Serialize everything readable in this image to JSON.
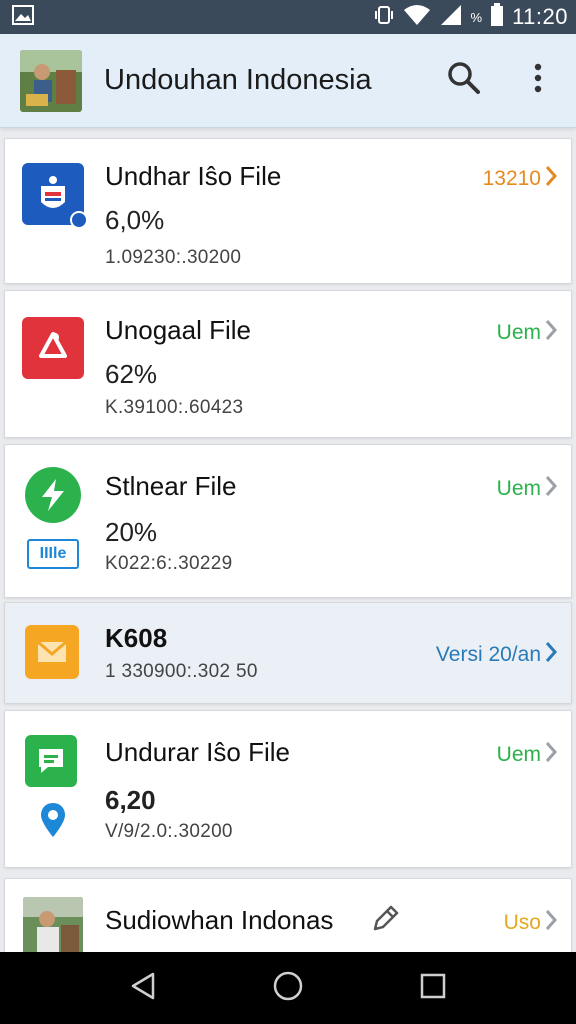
{
  "status_bar": {
    "time": "11:20",
    "battery_pct_label": "%",
    "icons": [
      "image-icon",
      "vibrate-icon",
      "wifi-icon",
      "signal-icon",
      "battery-icon"
    ]
  },
  "app_bar": {
    "title": "Undouhan Indonesia",
    "actions": [
      "search-icon",
      "more-vert-icon"
    ]
  },
  "items": [
    {
      "name": "Undhar Iŝo File",
      "percent": "6,0%",
      "meta": "1.09230:.30200",
      "right_label": "13210",
      "right_color": "#e58a1f",
      "icon": "shield-app-icon",
      "icon_bg": "#1e5bbf"
    },
    {
      "name": "Unogaal File",
      "percent": "62%",
      "meta": "K.39100:.60423",
      "right_label": "Uem",
      "right_color": "#2bb24c",
      "icon": "hanger-app-icon",
      "icon_bg": "#e0333b"
    },
    {
      "name": "Stlnear File",
      "percent": "20%",
      "meta": "K022:6:.30229",
      "right_label": "Uem",
      "right_color": "#2bb24c",
      "icon": "lightning-app-icon",
      "icon_bg": "#2bb24c",
      "sub_badge": "IIIle"
    },
    {
      "name": "K608",
      "percent": "",
      "meta": "1 330900:.302 50",
      "right_label": "Versi 20/an",
      "right_color": "#2a7ab8",
      "icon": "mail-app-icon",
      "icon_bg": "#f5a623"
    },
    {
      "name": "Undurar Iŝo File",
      "percent": "6,20",
      "meta": "V/9/2.0:.30200",
      "right_label": "Uem",
      "right_color": "#2bb24c",
      "icon": "chat-app-icon",
      "icon_bg": "#2bb24c"
    },
    {
      "name": "Sudiowhan Indonas",
      "percent": "",
      "meta": "",
      "right_label": "Uso",
      "right_color": "#e5a81f",
      "icon": "photo-avatar-icon",
      "icon_bg": "#6b8f5a"
    }
  ],
  "nav_bar": {
    "buttons": [
      "back-icon",
      "home-icon",
      "recents-icon"
    ]
  }
}
